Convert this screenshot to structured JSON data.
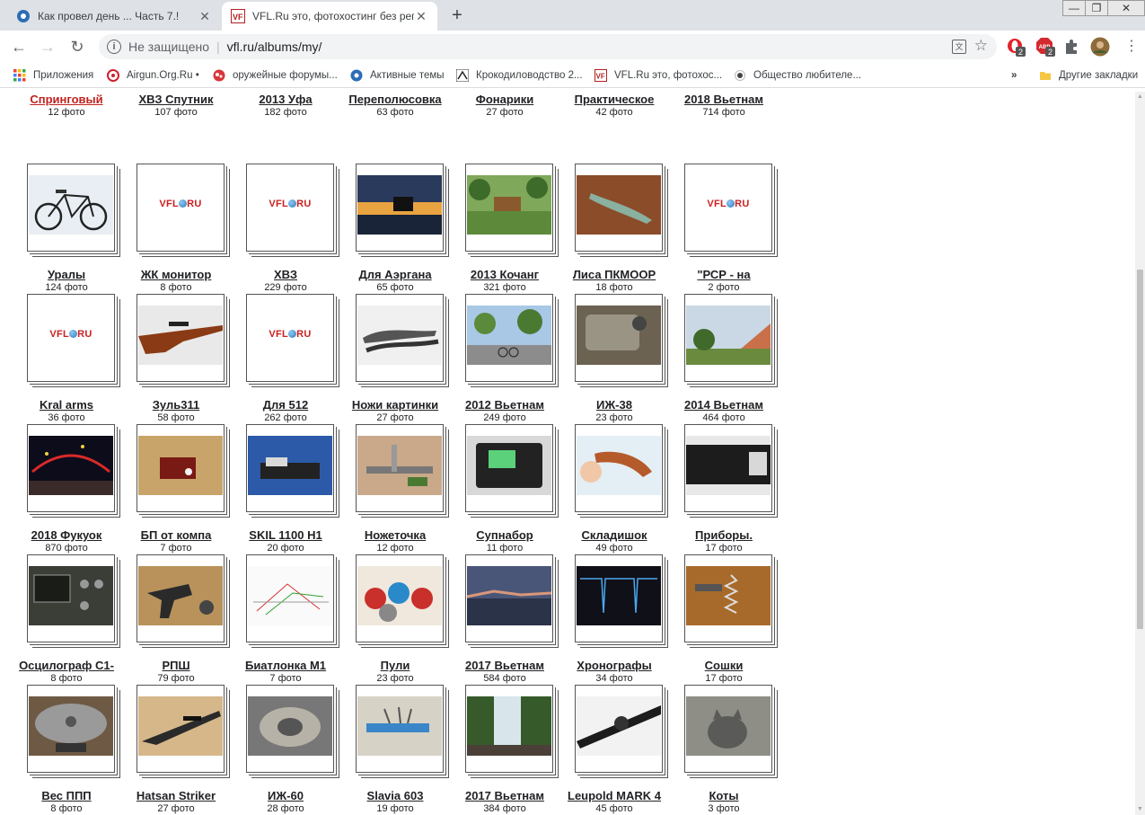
{
  "tabs": [
    {
      "title": "Как провел день ... Часть 7.!",
      "active": false
    },
    {
      "title": "VFL.Ru это, фотохостинг без регис",
      "active": true
    }
  ],
  "address": {
    "security": "Не защищено",
    "url": "vfl.ru/albums/my/"
  },
  "extensions": [
    {
      "badge": "2"
    },
    {
      "badge": "2"
    }
  ],
  "bookmarks": [
    {
      "label": "Приложения",
      "icon": "apps-grid-icon"
    },
    {
      "label": "Airgun.Org.Ru •",
      "icon": "airgun-icon"
    },
    {
      "label": "оружейные форумы...",
      "icon": "forum-icon"
    },
    {
      "label": "Активные темы",
      "icon": "topics-icon"
    },
    {
      "label": "Крокодиловодство 2...",
      "icon": "croc-icon"
    },
    {
      "label": "VFL.Ru это, фотохос...",
      "icon": "vfl-icon"
    },
    {
      "label": "Общество любителе...",
      "icon": "society-icon"
    }
  ],
  "bookmarks_more": "»",
  "other_bookmarks": "Другие закладки",
  "vfl_logo": {
    "left": "VFL",
    "right": "RU"
  },
  "albums": [
    {
      "name": "Спринговый",
      "count": "12 фото",
      "thumb": "partial",
      "red": true
    },
    {
      "name": "ХВЗ Спутник",
      "count": "107 фото",
      "thumb": "partial"
    },
    {
      "name": "2013 Уфа",
      "count": "182 фото",
      "thumb": "partial"
    },
    {
      "name": "Переполюсовка",
      "count": "63 фото",
      "thumb": "partial"
    },
    {
      "name": "Фонарики",
      "count": "27 фото",
      "thumb": "partial"
    },
    {
      "name": "Практическое",
      "count": "42 фото",
      "thumb": "partial"
    },
    {
      "name": "2018 Вьетнам",
      "count": "714 фото",
      "thumb": "partial"
    },
    {
      "name": "Уралы",
      "count": "124 фото",
      "thumb": "bicycle"
    },
    {
      "name": "ЖК монитор",
      "count": "8 фото",
      "thumb": "logo"
    },
    {
      "name": "ХВЗ",
      "count": "229 фото",
      "thumb": "logo"
    },
    {
      "name": "Для Аэргана",
      "count": "65 фото",
      "thumb": "sunset"
    },
    {
      "name": "2013 Кочанг",
      "count": "321 фото",
      "thumb": "garden"
    },
    {
      "name": "Лиса ПКМООР",
      "count": "18 фото",
      "thumb": "knife-wood"
    },
    {
      "name": "\"РСР - на",
      "count": "2 фото",
      "thumb": "logo"
    },
    {
      "name": "Kral arms",
      "count": "36 фото",
      "thumb": "logo"
    },
    {
      "name": "Зуль311",
      "count": "58 фото",
      "thumb": "rifle"
    },
    {
      "name": "Для 512",
      "count": "262 фото",
      "thumb": "logo"
    },
    {
      "name": "Ножи картинки",
      "count": "27 фото",
      "thumb": "knives"
    },
    {
      "name": "2012 Вьетнам",
      "count": "249 фото",
      "thumb": "street"
    },
    {
      "name": "ИЖ-38",
      "count": "23 фото",
      "thumb": "metal"
    },
    {
      "name": "2014 Вьетнам",
      "count": "464 фото",
      "thumb": "canyon"
    },
    {
      "name": "2018 Фукуок",
      "count": "870 фото",
      "thumb": "night"
    },
    {
      "name": "БП от компа",
      "count": "7 фото",
      "thumb": "psu"
    },
    {
      "name": "SKIL 1100 H1",
      "count": "20 фото",
      "thumb": "sander"
    },
    {
      "name": "Ножеточка",
      "count": "12 фото",
      "thumb": "tools"
    },
    {
      "name": "Супнабор",
      "count": "11 фото",
      "thumb": "device"
    },
    {
      "name": "Складишок",
      "count": "49 фото",
      "thumb": "folder-knife"
    },
    {
      "name": "Приборы.",
      "count": "17 фото",
      "thumb": "cutlery"
    },
    {
      "name": "Осцилограф С1-",
      "count": "8 фото",
      "thumb": "scope"
    },
    {
      "name": "РПШ",
      "count": "79 фото",
      "thumb": "revolver"
    },
    {
      "name": "Биатлонка М1",
      "count": "7 фото",
      "thumb": "drawing"
    },
    {
      "name": "Пули",
      "count": "23 фото",
      "thumb": "pellets"
    },
    {
      "name": "2017 Вьетнам",
      "count": "584 фото",
      "thumb": "sea"
    },
    {
      "name": "Хронографы",
      "count": "34 фото",
      "thumb": "graph"
    },
    {
      "name": "Сошки",
      "count": "17 фото",
      "thumb": "springs"
    },
    {
      "name": "Вес ППП",
      "count": "8 фото",
      "thumb": "scale"
    },
    {
      "name": "Hatsan Striker",
      "count": "27 фото",
      "thumb": "airgun"
    },
    {
      "name": "ИЖ-60",
      "count": "28 фото",
      "thumb": "part"
    },
    {
      "name": "Slavia 603",
      "count": "19 фото",
      "thumb": "workbench"
    },
    {
      "name": "2017 Вьетнам",
      "count": "384 фото",
      "thumb": "waterfall"
    },
    {
      "name": "Leupold MARK 4",
      "count": "45 фото",
      "thumb": "scope-rifle"
    },
    {
      "name": "Коты",
      "count": "3 фото",
      "thumb": "cat"
    }
  ]
}
